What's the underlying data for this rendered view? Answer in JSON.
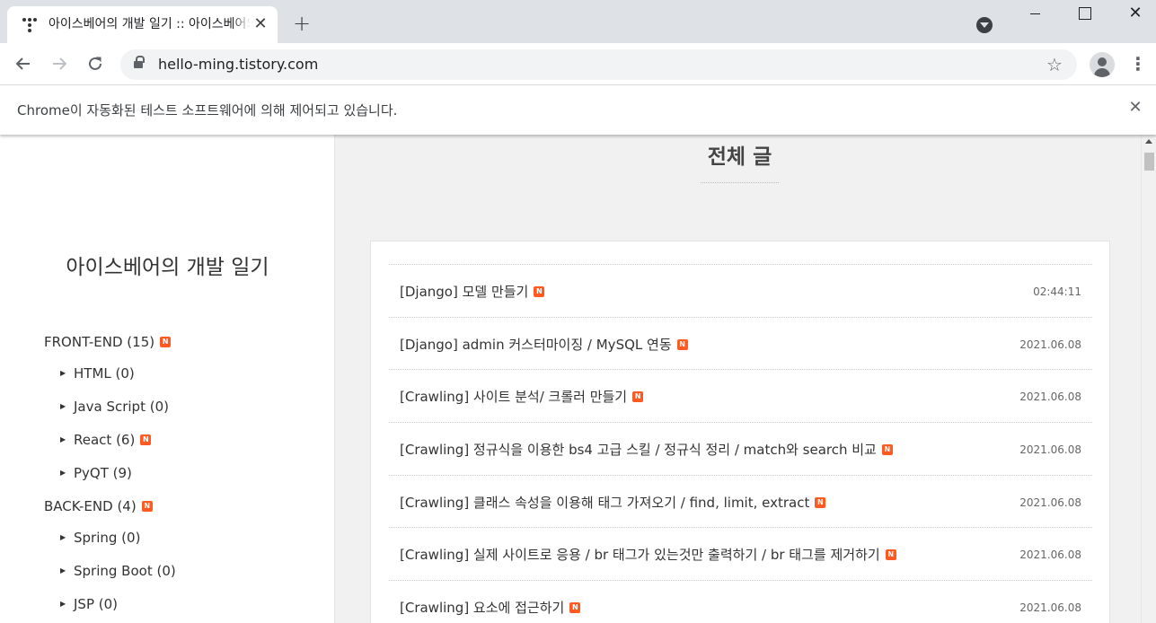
{
  "browser": {
    "tab_title": "아이스베어의 개발 일기 :: 아이스베어의 개발 일기",
    "tab_close": "✕",
    "new_tab": "+",
    "url": "hello-ming.tistory.com",
    "window_close": "✕",
    "icons": {
      "back": "arrow-left-icon",
      "forward": "arrow-right-icon",
      "reload": "reload-icon",
      "lock": "lock-icon",
      "star": "star-icon",
      "profile": "profile-icon",
      "menu": "kebab-menu-icon"
    }
  },
  "infobar": {
    "message": "Chrome이 자동화된 테스트 소프트웨어에 의해 제어되고 있습니다.",
    "close": "✕"
  },
  "sidebar": {
    "blog_title": "아이스베어의 개발 일기",
    "badge_text": "N",
    "categories": [
      {
        "label": "FRONT-END (15)",
        "level": 0,
        "new": true
      },
      {
        "label": "HTML (0)",
        "level": 1,
        "new": false
      },
      {
        "label": "Java Script (0)",
        "level": 1,
        "new": false
      },
      {
        "label": "React (6)",
        "level": 1,
        "new": true
      },
      {
        "label": "PyQT (9)",
        "level": 1,
        "new": false
      },
      {
        "label": "BACK-END (4)",
        "level": 0,
        "new": true
      },
      {
        "label": "Spring (0)",
        "level": 1,
        "new": false
      },
      {
        "label": "Spring Boot (0)",
        "level": 1,
        "new": false
      },
      {
        "label": "JSP (0)",
        "level": 1,
        "new": false
      }
    ]
  },
  "main": {
    "heading": "전체 글",
    "posts": [
      {
        "title": "[Django] 모델 만들기",
        "date": "02:44:11",
        "new": true
      },
      {
        "title": "[Django] admin 커스터마이징 / MySQL 연동",
        "date": "2021.06.08",
        "new": true
      },
      {
        "title": "[Crawling] 사이트 분석/ 크롤러 만들기",
        "date": "2021.06.08",
        "new": true
      },
      {
        "title": "[Crawling] 정규식을 이용한 bs4 고급 스킬 / 정규식 정리 / match와 search 비교",
        "date": "2021.06.08",
        "new": true
      },
      {
        "title": "[Crawling] 클래스 속성을 이용해 태그 가져오기 / find, limit, extract",
        "date": "2021.06.08",
        "new": true
      },
      {
        "title": "[Crawling] 실제 사이트로 응용 / br 태그가 있는것만 출력하기 / br 태그를 제거하기",
        "date": "2021.06.08",
        "new": true
      },
      {
        "title": "[Crawling] 요소에 접근하기",
        "date": "2021.06.08",
        "new": true
      }
    ]
  },
  "colors": {
    "badge": "#ff5a22",
    "page_bg": "#f1f1f1",
    "tabstrip_bg": "#dee1e6"
  }
}
